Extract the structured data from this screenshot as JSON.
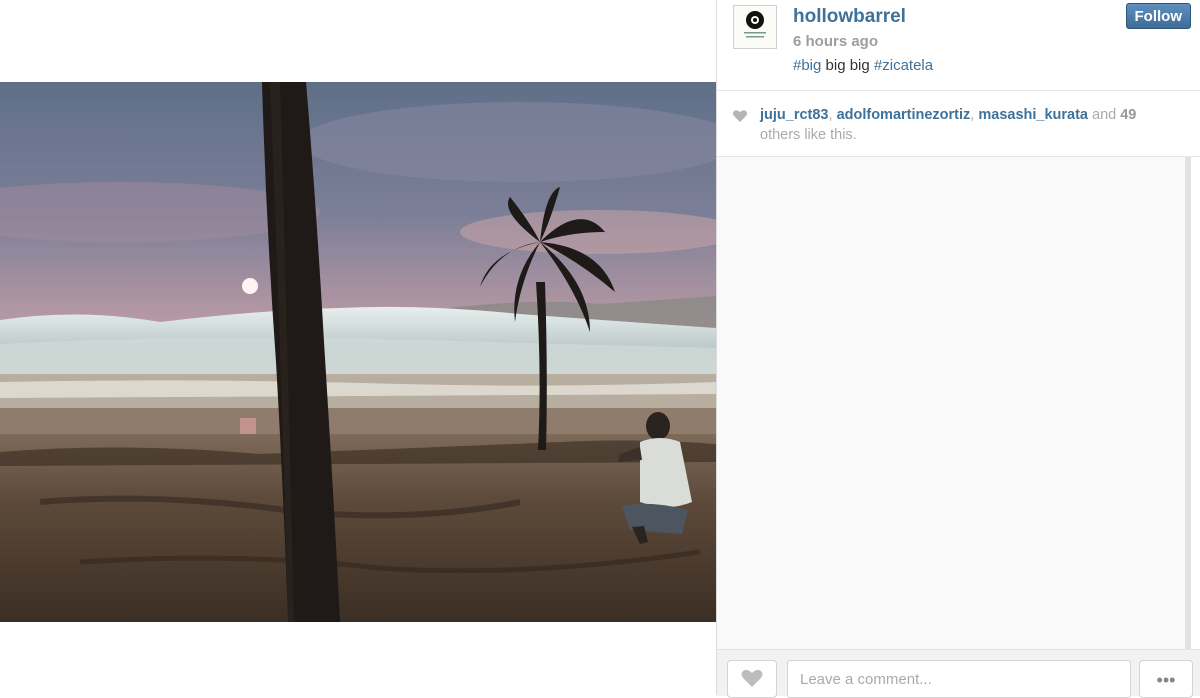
{
  "post": {
    "username": "hollowbarrel",
    "time": "6 hours ago",
    "caption": {
      "tag1": "#big",
      "text": " big big ",
      "tag2": "#zicatela"
    },
    "follow_label": "Follow"
  },
  "avatar": {
    "logo_line1": "HOLLOW BARREL",
    "logo_line2": "SURF CLOTHING"
  },
  "likes": {
    "users": [
      "juju_rct83",
      "adolfomartinezortiz",
      "masashi_kurata"
    ],
    "separator": ", ",
    "and_text": " and ",
    "count": "49",
    "suffix": " others like this."
  },
  "comment_box": {
    "placeholder": "Leave a comment..."
  },
  "more_label": "•••",
  "colors": {
    "link": "#3f729b",
    "follow_button": "#4a7aa8"
  }
}
